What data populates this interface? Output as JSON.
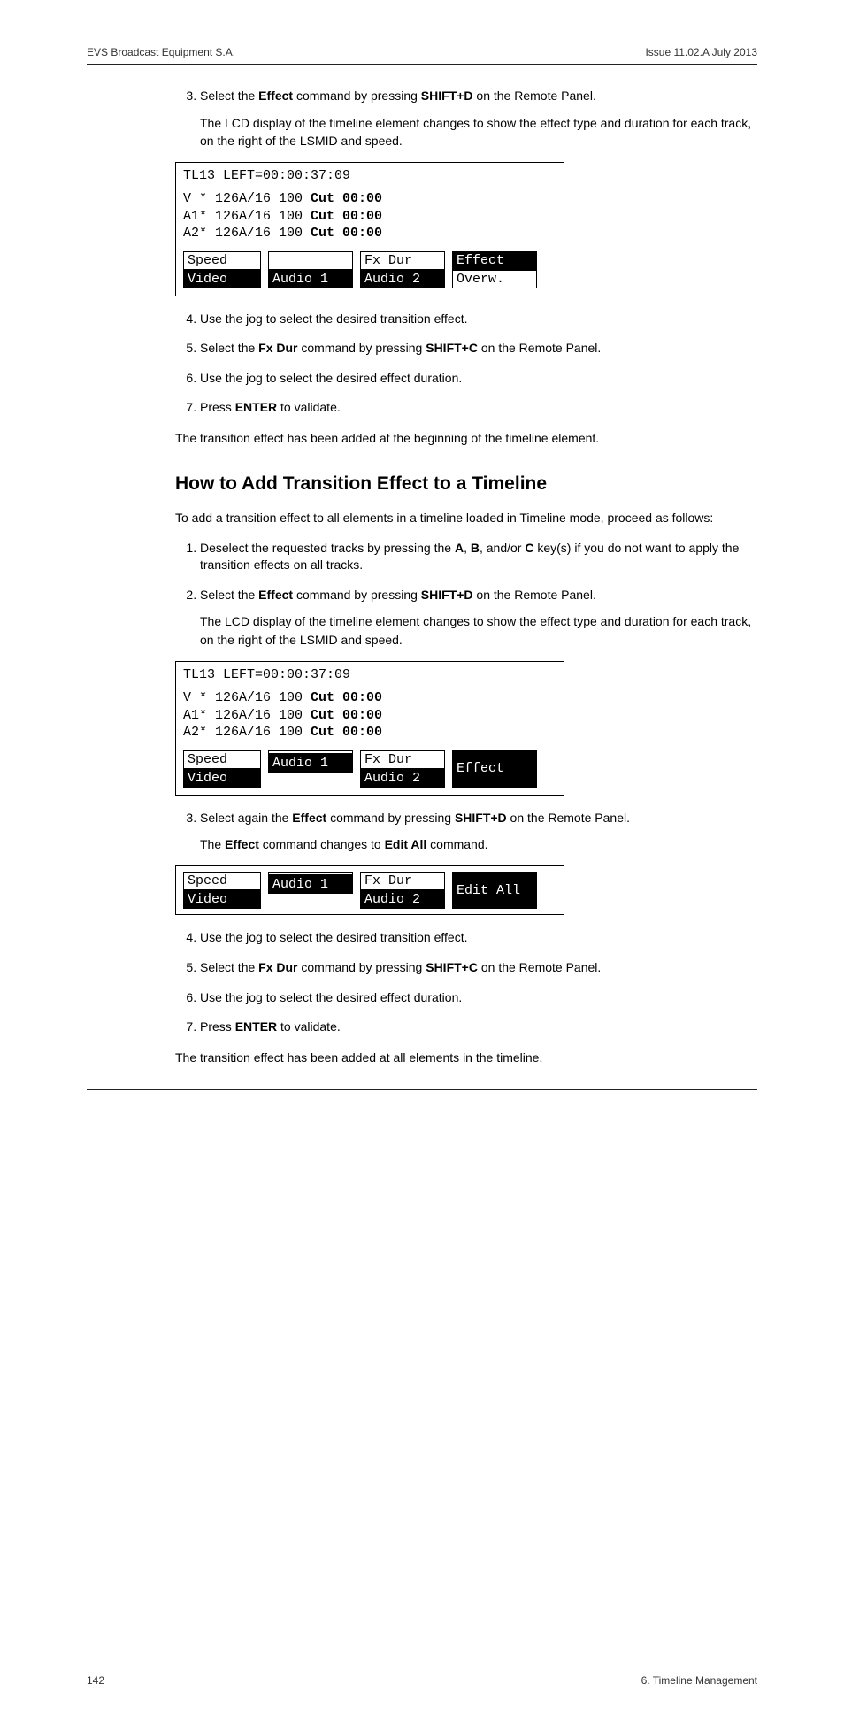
{
  "header": {
    "left": "EVS Broadcast Equipment S.A.",
    "right": "Issue 11.02.A  July 2013"
  },
  "sec1": {
    "o3": {
      "num": "3.",
      "text_a": "Select the ",
      "b1": "Effect",
      "text_b": " command by pressing ",
      "b2": "SHIFT+D",
      "text_c": " on the Remote Panel.",
      "sub": "The LCD display of the timeline element changes to show the effect type and duration for each track, on the right of the LSMID and speed."
    },
    "lcd1": {
      "title": "TL13 LEFT=00:00:37:09",
      "l1a": "V * 126A/16 100 ",
      "l1b": "Cut 00:00",
      "l2a": "A1* 126A/16 100 ",
      "l2b": "Cut 00:00",
      "l3a": "A2* 126A/16 100 ",
      "l3b": "Cut 00:00",
      "r1": {
        "c1": "Speed",
        "c2": "",
        "c3": "Fx Dur",
        "c4": "Effect"
      },
      "r2": {
        "c1": "Video",
        "c2": "Audio 1",
        "c3": "Audio 2",
        "c4": "Overw."
      }
    },
    "o4": "Use the jog to select the desired transition effect.",
    "o5": {
      "a": "Select the ",
      "b1": "Fx Dur",
      "b": " command by pressing ",
      "b2": "SHIFT+C",
      "c": " on the Remote Panel."
    },
    "o6": "Use the jog to select the desired effect duration.",
    "o7": {
      "a": "Press ",
      "b": "ENTER",
      "c": " to validate."
    },
    "final": "The transition effect has been added at the beginning of the timeline element."
  },
  "heading": "How to Add Transition Effect to a Timeline",
  "sec2": {
    "intro": "To add a transition effect to all elements in a timeline loaded in Timeline mode, proceed as follows:",
    "o1": {
      "a": "Deselect the requested tracks by pressing the ",
      "bA": "A",
      "comma1": ", ",
      "bB": "B",
      "comma2": ", and/or ",
      "bC": "C",
      "c": " key(s) if you do not want to apply the transition effects on all tracks."
    },
    "o2": {
      "a": "Select the ",
      "b1": "Effect",
      "b": " command by pressing ",
      "b2": "SHIFT+D",
      "c": " on the Remote Panel.",
      "sub": "The LCD display of the timeline element changes to show the effect type and duration for each track, on the right of the LSMID and speed."
    },
    "lcd2": {
      "title": "TL13 LEFT=00:00:37:09",
      "l1a": "V * 126A/16 100 ",
      "l1b": "Cut 00:00",
      "l2a": "A1* 126A/16 100 ",
      "l2b": "Cut 00:00",
      "l3a": "A2* 126A/16 100 ",
      "l3b": "Cut 00:00",
      "r1": {
        "c1": "Speed",
        "c2": "",
        "c3": "Fx Dur",
        "c4": "Effect"
      },
      "r2": {
        "c1": "Video",
        "c2": "Audio 1",
        "c3": "Audio 2"
      }
    },
    "o3": {
      "a": "Select again the ",
      "b1": "Effect",
      "b": " command by pressing ",
      "b2": "SHIFT+D",
      "c": " on the Remote Panel.",
      "sub_a": "The ",
      "sub_b1": "Effect",
      "sub_b": " command changes to ",
      "sub_b2": "Edit All",
      "sub_c": " command."
    },
    "lcd3": {
      "r1": {
        "c1": "Speed",
        "c2": "",
        "c3": "Fx Dur",
        "c4": "Edit All"
      },
      "r2": {
        "c1": "Video",
        "c2": "Audio 1",
        "c3": "Audio 2"
      }
    },
    "o4": "Use the jog to select the desired transition effect.",
    "o5": {
      "a": "Select the ",
      "b1": "Fx Dur",
      "b": " command by pressing ",
      "b2": "SHIFT+C",
      "c": " on the Remote Panel."
    },
    "o6": "Use the jog to select the desired effect duration.",
    "o7": {
      "a": "Press ",
      "b": "ENTER",
      "c": " to validate."
    },
    "final": "The transition effect has been added at all elements in the timeline."
  },
  "footer": {
    "left": "142",
    "right": "6. Timeline Management"
  }
}
